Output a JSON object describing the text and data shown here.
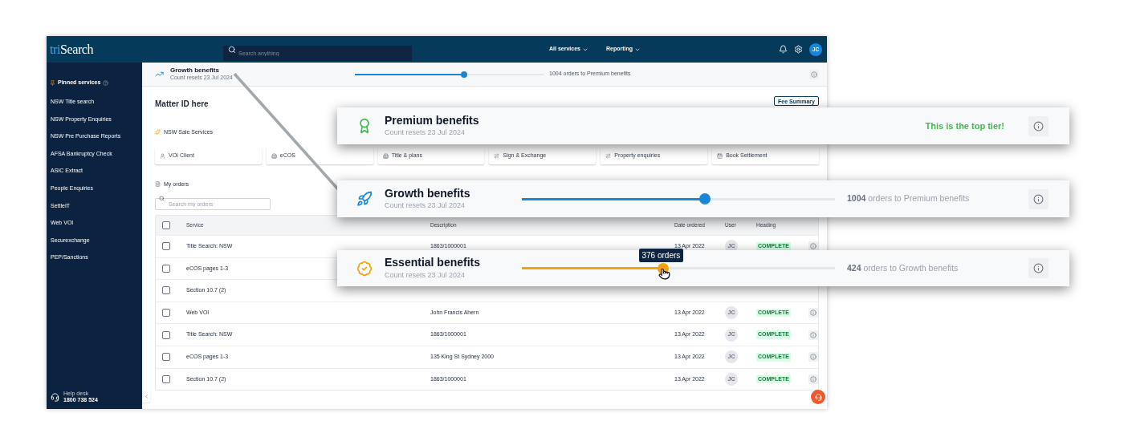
{
  "topbar": {
    "logo_prefix": "tri",
    "logo_main": "Search",
    "search_placeholder": "Search anything",
    "nav": [
      {
        "label": "All services"
      },
      {
        "label": "Reporting"
      }
    ],
    "avatar": "JC"
  },
  "sidebar": {
    "section": "Pinned services",
    "items": [
      "NSW Title search",
      "NSW Property Enquiries",
      "NSW Pre Purchase Reports",
      "AFSA Bankruptcy Check",
      "ASIC Extract",
      "People Enquiries",
      "SettleIT",
      "Web VOI",
      "Securexchange",
      "PEP/Sanctions"
    ],
    "help_label": "Help desk",
    "help_phone": "1800 738 524"
  },
  "benefit_bar": {
    "title": "Growth benefits",
    "subtitle": "Count resets 23 Jul 2024",
    "level": 0.58,
    "reading": "1004 orders to Premium benefits"
  },
  "main": {
    "title": "Matter ID here",
    "fee_button": "Fee Summary",
    "services_heading": "NSW Sale Services",
    "tiles": [
      "VOI Client",
      "eCOS",
      "Title & plans",
      "Sign & Exchange",
      "Property enquiries",
      "Book Settlement"
    ],
    "orders_heading": "My orders",
    "orders_search_placeholder": "Search my orders"
  },
  "table": {
    "select_all_checked": false,
    "columns": [
      "Service",
      "Description",
      "Date ordered",
      "User",
      "Heading"
    ],
    "rows": [
      {
        "checked": false,
        "service": "Title Search: NSW",
        "description": "1863/1000001",
        "date": "13 Apr 2022",
        "user": "JC",
        "status": "COMPLETE"
      },
      {
        "checked": false,
        "service": "eCOS pages 1-3"
      },
      {
        "checked": false,
        "service": "Section 10.7 (2)"
      },
      {
        "checked": false,
        "service": "Web VOI",
        "description": "John Francis Ahern",
        "date": "13 Apr 2022",
        "user": "JC",
        "status": "COMPLETE"
      },
      {
        "checked": false,
        "service": "Title Search: NSW",
        "description": "1863/1000001",
        "date": "13 Apr 2022",
        "user": "JC",
        "status": "COMPLETE"
      },
      {
        "checked": false,
        "service": "eCOS pages 1-3",
        "description": "135 King St Sydney 2000",
        "date": "13 Apr 2022",
        "user": "JC",
        "status": "COMPLETE"
      },
      {
        "checked": false,
        "service": "Section 10.7 (2)",
        "description": "1863/1000001",
        "date": "13 Apr 2022",
        "user": "JC",
        "status": "COMPLETE"
      }
    ]
  },
  "tier_cards": [
    {
      "kind": "message",
      "color": "#3fb950",
      "title": "Premium benefits",
      "subtitle": "Count resets 23 Jul 2024",
      "message": "This is the top tier!"
    },
    {
      "kind": "slider",
      "color": "#1a86d9",
      "title": "Growth benefits",
      "subtitle": "Count resets 23 Jul 2024",
      "level": 0.585,
      "reading": "**1004** orders to Premium benefits"
    },
    {
      "kind": "slider",
      "color": "#f5a30a",
      "title": "Essential benefits",
      "subtitle": "Count resets 23 Jul 2024",
      "level": 0.45,
      "reading": "**424** orders to Growth benefits",
      "tooltip": "376 orders"
    }
  ]
}
